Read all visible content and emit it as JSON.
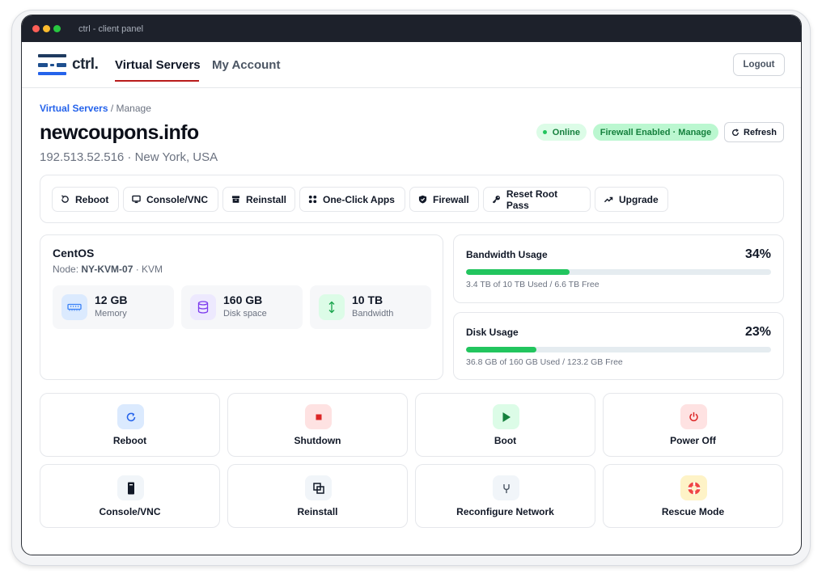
{
  "window": {
    "title": "ctrl - client panel"
  },
  "nav": {
    "logo_text": "ctrl.",
    "links": [
      "Virtual Servers",
      "My Account"
    ],
    "logout_label": "Logout"
  },
  "breadcrumb": {
    "link": "Virtual Servers",
    "separator": " / ",
    "current": "Manage"
  },
  "server": {
    "hostname": "newcoupons.info",
    "address_line": "192.513.52.516 · New York, USA",
    "status": "Online",
    "firewall_badge": "Firewall Enabled · Manage",
    "refresh_label": "Refresh"
  },
  "toolbar": {
    "buttons": [
      {
        "label": "Reboot",
        "icon": "reboot-icon"
      },
      {
        "label": "Console/VNC",
        "icon": "monitor-icon"
      },
      {
        "label": "Reinstall",
        "icon": "archive-icon"
      },
      {
        "label": "One-Click Apps",
        "icon": "apps-grid-icon"
      },
      {
        "label": "Firewall",
        "icon": "shield-icon"
      },
      {
        "label": "Reset Root Pass",
        "icon": "key-icon"
      },
      {
        "label": "Upgrade",
        "icon": "trend-up-icon"
      }
    ]
  },
  "os_card": {
    "title": "CentOS",
    "node_prefix": "Node: ",
    "node_name": "NY-KVM-07",
    "node_suffix": " · KVM",
    "specs": [
      {
        "value": "12 GB",
        "label": "Memory",
        "icon": "memory-icon"
      },
      {
        "value": "160 GB",
        "label": "Disk space",
        "icon": "database-icon"
      },
      {
        "value": "10 TB",
        "label": "Bandwidth",
        "icon": "arrows-vertical-icon"
      }
    ]
  },
  "bandwidth": {
    "title": "Bandwidth Usage",
    "percent_label": "34%",
    "percent": 34,
    "detail": "3.4 TB of 10 TB Used / 6.6 TB Free"
  },
  "disk": {
    "title": "Disk Usage",
    "percent_label": "23%",
    "percent": 23,
    "detail": "36.8 GB of 160 GB Used / 123.2 GB Free"
  },
  "actions": [
    {
      "label": "Reboot",
      "icon": "reboot-icon"
    },
    {
      "label": "Shutdown",
      "icon": "stop-icon"
    },
    {
      "label": "Boot",
      "icon": "play-icon"
    },
    {
      "label": "Power Off",
      "icon": "power-icon"
    },
    {
      "label": "Console/VNC",
      "icon": "console-icon"
    },
    {
      "label": "Reinstall",
      "icon": "reinstall-icon"
    },
    {
      "label": "Reconfigure Network",
      "icon": "network-icon"
    },
    {
      "label": "Rescue Mode",
      "icon": "lifebuoy-icon"
    }
  ],
  "colors": {
    "titlebar": "#1d212b",
    "accent_link": "#2563eb",
    "nav_active_underline": "#b91c1c",
    "status_green": "#22c55e",
    "progress_fill": "#22c55e"
  }
}
